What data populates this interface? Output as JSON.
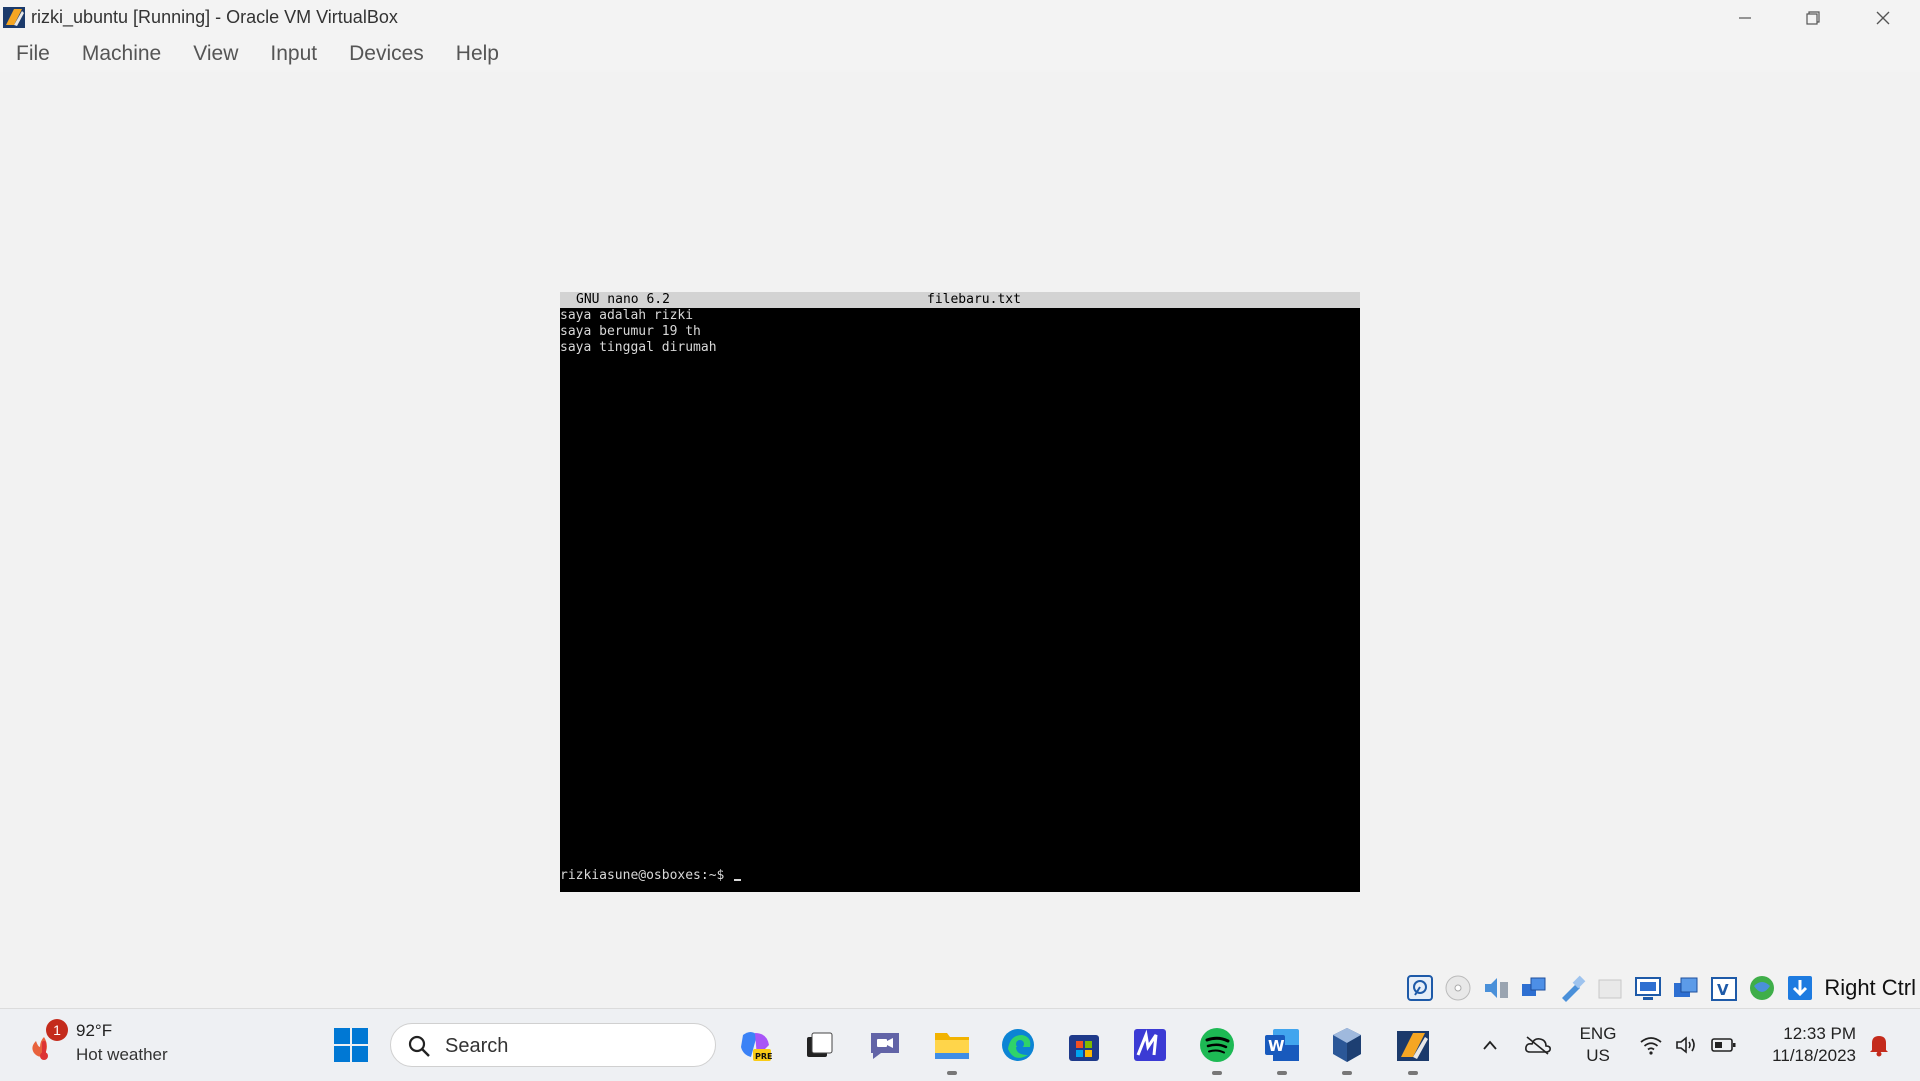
{
  "window": {
    "title": "rizki_ubuntu [Running] - Oracle VM VirtualBox"
  },
  "menu": [
    "File",
    "Machine",
    "View",
    "Input",
    "Devices",
    "Help"
  ],
  "nano": {
    "version": "GNU nano 6.2",
    "filename": "filebaru.txt",
    "lines": [
      "saya adalah rizki",
      "saya berumur 19 th",
      "saya tinggal dirumah"
    ],
    "prompt": "rizkiasune@osboxes:~$"
  },
  "vbox_status": {
    "icons": [
      "hard-disk-icon",
      "optical-drive-icon",
      "audio-icon",
      "network-icon",
      "usb-icon",
      "shared-folders-icon",
      "display-icon",
      "recording-icon",
      "vt-x-icon",
      "guest-additions-icon",
      "mouse-integration-icon"
    ],
    "host_key": "Right Ctrl"
  },
  "taskbar": {
    "weather": {
      "temp": "92°F",
      "desc": "Hot weather",
      "badge": "1"
    },
    "search_placeholder": "Search",
    "lang": {
      "line1": "ENG",
      "line2": "US"
    },
    "clock": {
      "time": "12:33 PM",
      "date": "11/18/2023"
    }
  },
  "colors": {
    "terminal_bg": "#000000",
    "nano_header_bg": "#d3d3d3",
    "windows_blue": "#0078d4",
    "spotify_green": "#1db954"
  }
}
